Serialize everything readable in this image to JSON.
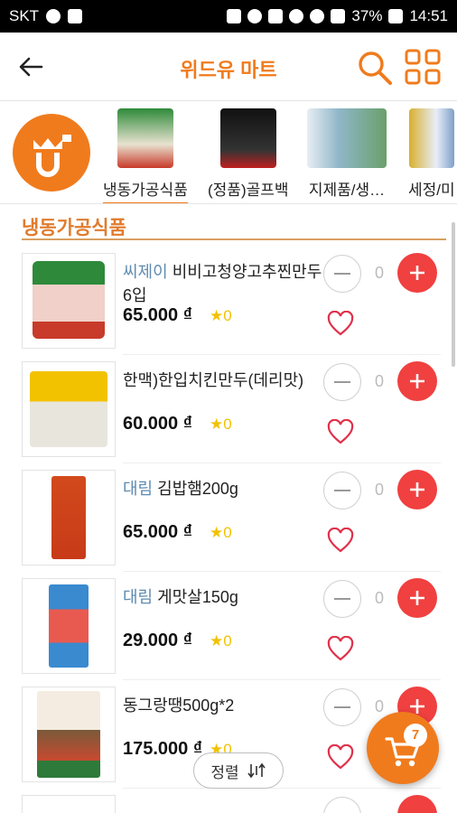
{
  "status_bar": {
    "carrier": "SKT",
    "battery": "37%",
    "time": "14:51",
    "left_icons": [
      "chat-bubble-icon",
      "image-icon"
    ],
    "right_icons": [
      "lock-icon",
      "recycle-icon",
      "mute-icon",
      "alarm-icon",
      "wifi-icon",
      "signal-icon",
      "battery-icon"
    ]
  },
  "header": {
    "title": "위드유 마트",
    "back_icon": "arrow-left-icon",
    "search_icon": "search-icon",
    "grid_icon": "grid-icon"
  },
  "categories": [
    {
      "label": "냉동가공식품",
      "active": true
    },
    {
      "label": "(정품)골프백",
      "active": false
    },
    {
      "label": "지제품/생…",
      "active": false
    },
    {
      "label": "세정/미",
      "active": false
    }
  ],
  "section": {
    "title": "냉동가공식품"
  },
  "products": [
    {
      "brand": "씨제이",
      "name": "비비고청양고추찐만두6입",
      "price": "65.000 ₫",
      "rating": "0",
      "qty": "0"
    },
    {
      "brand": "",
      "name": "한맥)한입치킨만두(데리맛)",
      "price": "60.000 ₫",
      "rating": "0",
      "qty": "0"
    },
    {
      "brand": "대림",
      "name": "김밥햄200g",
      "price": "65.000 ₫",
      "rating": "0",
      "qty": "0"
    },
    {
      "brand": "대림",
      "name": "게맛살150g",
      "price": "29.000 ₫",
      "rating": "0",
      "qty": "0"
    },
    {
      "brand": "",
      "name": "동그랑땡500g*2",
      "price": "175.000 ₫",
      "rating": "0",
      "qty": "0"
    }
  ],
  "sort_button": {
    "label": "정렬"
  },
  "cart": {
    "count": "7"
  },
  "colors": {
    "accent": "#f07b1d",
    "plus": "#f04040",
    "brand_text": "#5f8bb0",
    "star": "#f2c200"
  }
}
